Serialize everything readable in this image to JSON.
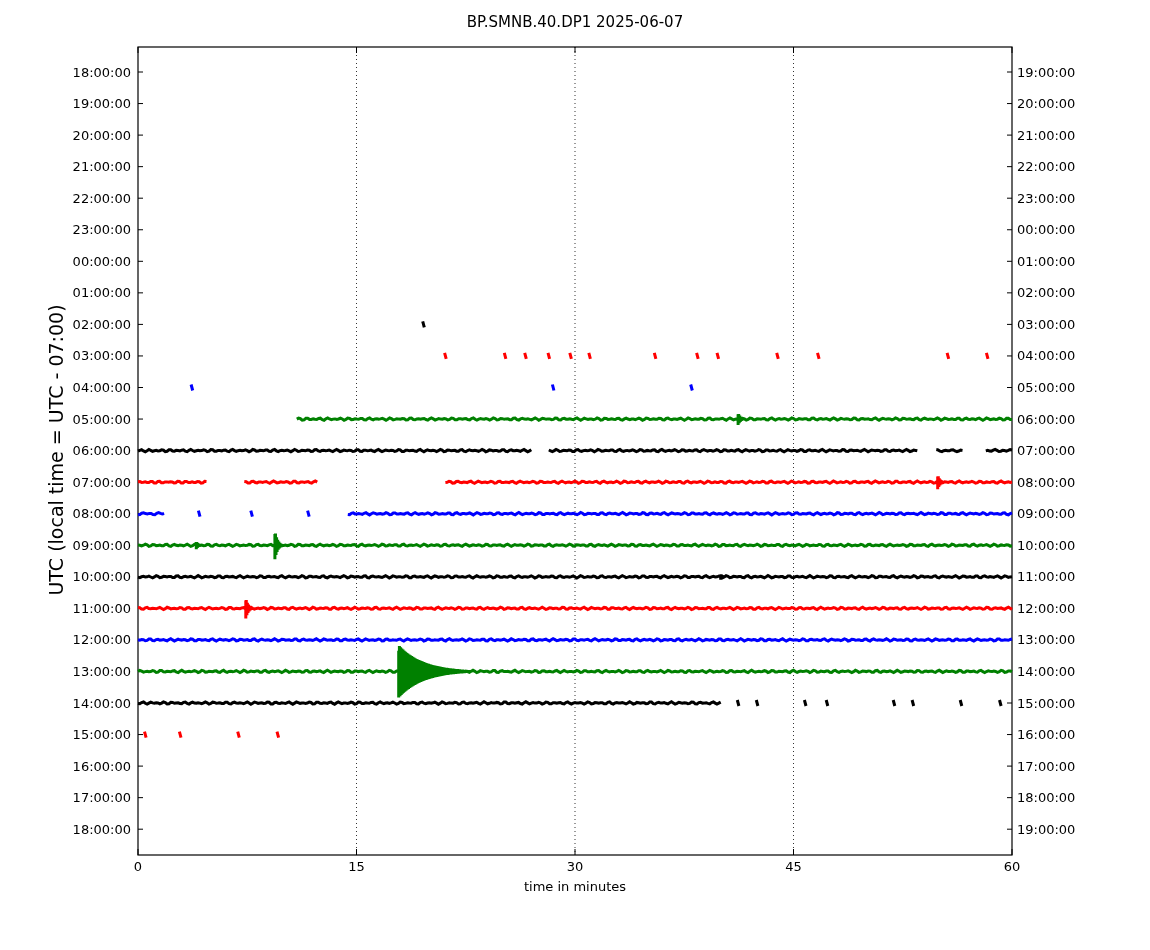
{
  "plot": {
    "title": "BP.SMNB.40.DP1 2025-06-07",
    "ylabel": "UTC (local time = UTC - 07:00)",
    "xlabel": "time in minutes",
    "xticks": [
      "0",
      "15",
      "30",
      "45",
      "60"
    ],
    "rows": [
      {
        "utc": "18:00:00",
        "local": "19:00:00"
      },
      {
        "utc": "19:00:00",
        "local": "20:00:00"
      },
      {
        "utc": "20:00:00",
        "local": "21:00:00"
      },
      {
        "utc": "21:00:00",
        "local": "22:00:00"
      },
      {
        "utc": "22:00:00",
        "local": "23:00:00"
      },
      {
        "utc": "23:00:00",
        "local": "00:00:00"
      },
      {
        "utc": "00:00:00",
        "local": "01:00:00"
      },
      {
        "utc": "01:00:00",
        "local": "02:00:00"
      },
      {
        "utc": "02:00:00",
        "local": "03:00:00",
        "color": "#000000"
      },
      {
        "utc": "03:00:00",
        "local": "04:00:00",
        "color": "#ff0000"
      },
      {
        "utc": "04:00:00",
        "local": "05:00:00",
        "color": "#0000ff"
      },
      {
        "utc": "05:00:00",
        "local": "06:00:00",
        "color": "#008000"
      },
      {
        "utc": "06:00:00",
        "local": "07:00:00",
        "color": "#000000"
      },
      {
        "utc": "07:00:00",
        "local": "08:00:00",
        "color": "#ff0000"
      },
      {
        "utc": "08:00:00",
        "local": "09:00:00",
        "color": "#0000ff"
      },
      {
        "utc": "09:00:00",
        "local": "10:00:00",
        "color": "#008000"
      },
      {
        "utc": "10:00:00",
        "local": "11:00:00",
        "color": "#000000"
      },
      {
        "utc": "11:00:00",
        "local": "12:00:00",
        "color": "#ff0000"
      },
      {
        "utc": "12:00:00",
        "local": "13:00:00",
        "color": "#0000ff"
      },
      {
        "utc": "13:00:00",
        "local": "14:00:00",
        "color": "#008000"
      },
      {
        "utc": "14:00:00",
        "local": "15:00:00",
        "color": "#000000"
      },
      {
        "utc": "15:00:00",
        "local": "16:00:00",
        "color": "#ff0000"
      },
      {
        "utc": "16:00:00",
        "local": "17:00:00"
      },
      {
        "utc": "17:00:00",
        "local": "18:00:00"
      },
      {
        "utc": "18:00:00",
        "local": "19:00:00"
      }
    ]
  }
}
